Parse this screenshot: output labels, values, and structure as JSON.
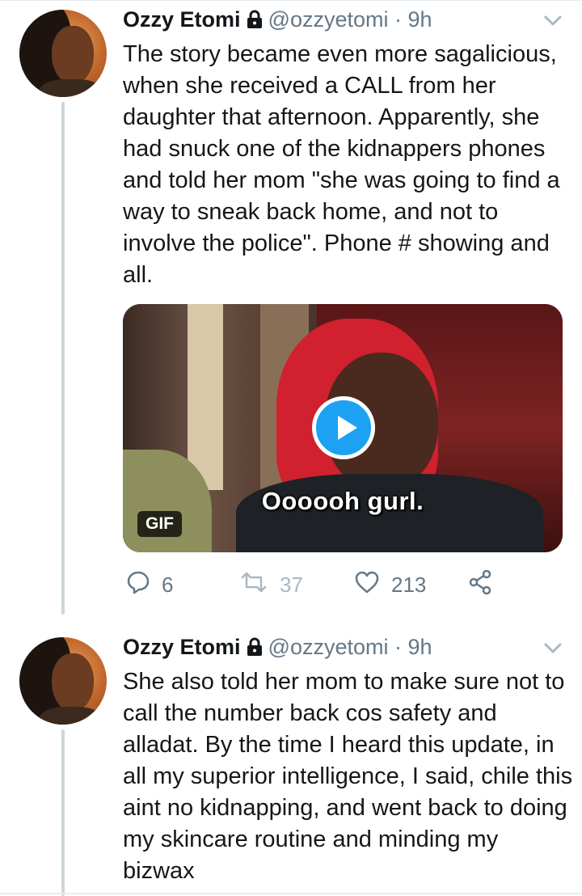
{
  "tweets": [
    {
      "name": "Ozzy Etomi",
      "handle": "@ozzyetomi",
      "separator": "·",
      "time": "9h",
      "text": "The story became even more sagalicious, when she received a CALL from her daughter that afternoon. Apparently, she had snuck one of the kidnappers phones and told her mom \"she was going to find a way to sneak back home, and not to involve the police\". Phone # showing and all.",
      "media": {
        "caption": "Oooooh gurl.",
        "badge": "GIF"
      },
      "actions": {
        "replies": "6",
        "retweets": "37",
        "likes": "213"
      }
    },
    {
      "name": "Ozzy Etomi",
      "handle": "@ozzyetomi",
      "separator": "·",
      "time": "9h",
      "text": "She also told her mom to make sure not to call the number back cos safety and alladat. By the time I heard this update, in all my superior intelligence, I said, chile this aint no kidnapping, and went back to doing my skincare routine and minding my bizwax"
    }
  ],
  "colors": {
    "accent": "#1da1f2",
    "text": "#14171a",
    "secondary": "#657786",
    "thread_line": "#cdd6dd"
  },
  "icons": [
    "lock-icon",
    "chevron-down-icon",
    "reply-icon",
    "retweet-icon",
    "like-icon",
    "share-icon",
    "play-icon"
  ]
}
